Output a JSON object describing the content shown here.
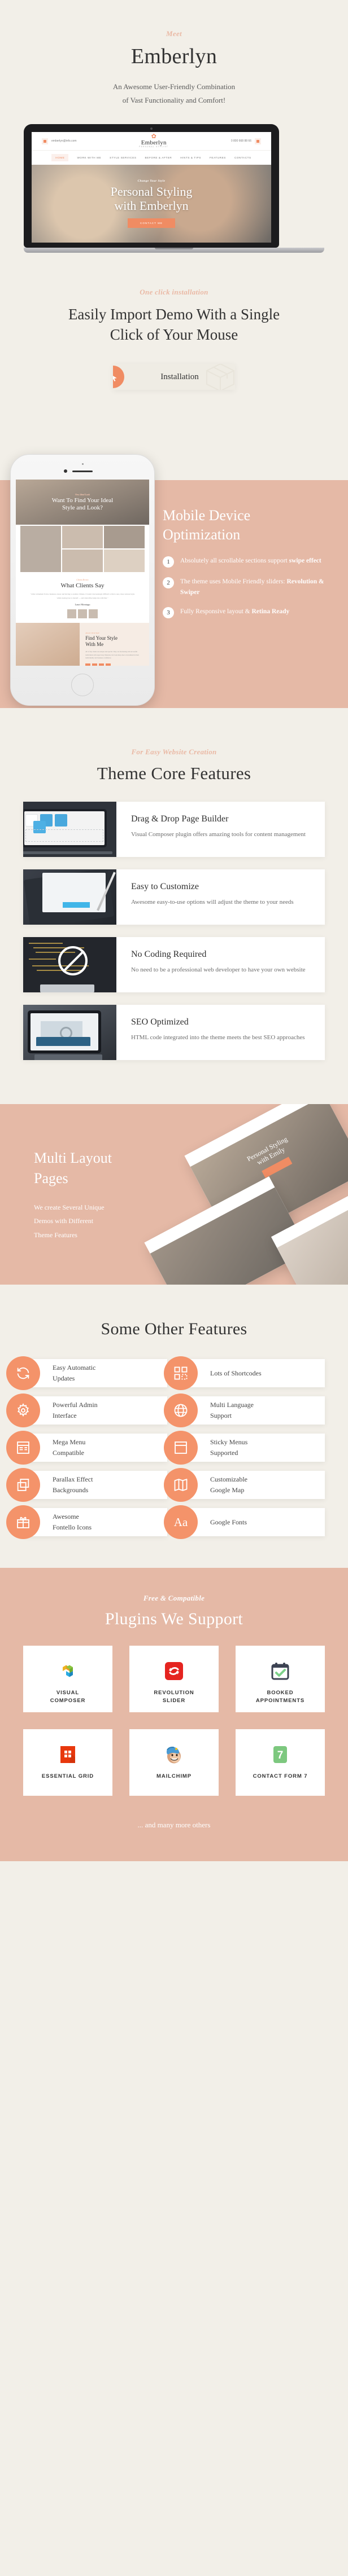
{
  "hero": {
    "eyebrow": "Meet",
    "title": "Emberlyn",
    "subtitle_line1": "An Awesome User-Friendly Combination",
    "subtitle_line2": "of Vast Functionality  and Comfort!",
    "laptop": {
      "email": "emberlyn@info.com",
      "phone": "0 800 668 88 66",
      "brand": "Emberlyn",
      "brand_tagline": "PERSONAL STYLIST",
      "nav": [
        "HOME",
        "WORK WITH ME",
        "STYLE SERVICES",
        "BEFORE & AFTER",
        "HINTS & TIPS",
        "FEATURES",
        "CONTACTS"
      ],
      "slide_eyebrow": "Change Your Style",
      "slide_title_line1": "Personal Styling",
      "slide_title_line2": "with Emberlyn",
      "slide_button": "CONTACT ME"
    }
  },
  "install": {
    "eyebrow": "One click installation",
    "title_line1": "Easily Import Demo With a Single",
    "title_line2": "Click of Your Mouse",
    "button_label": "Installation",
    "cursor_icon": "click-cursor-icon",
    "box_icon": "package-box-icon"
  },
  "mobile": {
    "title_line1": "Mobile Device",
    "title_line2": "Optimization",
    "items": [
      {
        "num": "1",
        "text": "Absolutely all scrollable sections support ",
        "bold": "swipe effect"
      },
      {
        "num": "2",
        "text": "The theme uses Mobile Friendly sliders: ",
        "bold": "Revolution & Swiper"
      },
      {
        "num": "3",
        "text": "Fully Responsive layout & ",
        "bold": "Retina Ready"
      }
    ],
    "phone_screen": {
      "hero_eyebrow": "New Ideal Look",
      "hero_title_line1": "Want To Find Your Ideal",
      "hero_title_line2": "Style and Look?",
      "clients_eyebrow": "Clients Review",
      "clients_title": "What Clients Say",
      "clients_quote": "\"After retirement from a business career and having to another climate, I found it increasingly difficult to find a new, more relaxed style while staying true to myself — and when Mae helps me with that.\"",
      "clients_name": "Lauri Montagu",
      "clients_role": "MY STYLIST",
      "find_eyebrow": "About Client Style",
      "find_title_line1": "Find Your Style",
      "find_title_line2": "With Me",
      "find_text": "All of my clients are unique and special. They are fascinating and successful individuals with super busy lifestyles, but look sharp due to investment in their individuality and business confidence."
    }
  },
  "core": {
    "eyebrow": "For Easy Website Creation",
    "title": "Theme Core Features",
    "features": [
      {
        "art": "art-vc",
        "title": "Drag & Drop Page Builder",
        "desc": "Visual Composer plugin offers amazing tools for content management",
        "art_caption": "Drag here to add widgets"
      },
      {
        "art": "art-cust",
        "title": "Easy to Customize",
        "desc": "Awesome easy-to-use options will adjust the theme to your needs"
      },
      {
        "art": "art-code",
        "title": "No Coding Required",
        "desc": "No need to be a professional web developer to have your own website"
      },
      {
        "art": "art-seo",
        "title": "SEO Optimized",
        "desc": "HTML code integrated into the theme meets the best SEO approaches"
      }
    ]
  },
  "multi": {
    "title_line1": "Multi Layout",
    "title_line2": "Pages",
    "desc_line1": "We create Several Unique",
    "desc_line2": "Demos with Different",
    "desc_line3": "Theme Features",
    "shot_title_line1": "Personal Styling",
    "shot_title_line2": "with Emily"
  },
  "other": {
    "title": "Some Other Features",
    "items": [
      {
        "icon": "refresh-icon",
        "label_line1": "Easy Automatic",
        "label_line2": "Updates"
      },
      {
        "icon": "shortcodes-grid-icon",
        "label_line1": "Lots of Shortcodes",
        "label_line2": ""
      },
      {
        "icon": "gear-icon",
        "label_line1": "Powerful Admin",
        "label_line2": "Interface"
      },
      {
        "icon": "globe-icon",
        "label_line1": "Multi Language",
        "label_line2": "Support"
      },
      {
        "icon": "mega-menu-icon",
        "label_line1": "Mega Menu",
        "label_line2": "Compatible"
      },
      {
        "icon": "sticky-menu-icon",
        "label_line1": "Sticky Menus",
        "label_line2": "Supported"
      },
      {
        "icon": "layers-icon",
        "label_line1": "Parallax Effect",
        "label_line2": "Backgrounds"
      },
      {
        "icon": "map-icon",
        "label_line1": "Customizable",
        "label_line2": "Google Map"
      },
      {
        "icon": "gift-icon",
        "label_line1": "Awesome",
        "label_line2": "Fontello Icons"
      },
      {
        "icon": "font-aa-icon",
        "label_line1": "Google Fonts",
        "label_line2": ""
      }
    ]
  },
  "plugins": {
    "eyebrow": "Free & Compatible",
    "title": "Plugins We Support",
    "items": [
      {
        "icon": "visual-composer-logo",
        "name_line1": "VISUAL",
        "name_line2": "COMPOSER"
      },
      {
        "icon": "revolution-slider-logo",
        "name_line1": "REVOLUTION",
        "name_line2": "SLIDER"
      },
      {
        "icon": "booked-appointments-logo",
        "name_line1": "BOOKED",
        "name_line2": "APPOINTMENTS"
      },
      {
        "icon": "essential-grid-logo",
        "name_line1": "ESSENTIAL GRID",
        "name_line2": ""
      },
      {
        "icon": "mailchimp-logo",
        "name_line1": "MAILCHIMP",
        "name_line2": ""
      },
      {
        "icon": "contact-form-7-logo",
        "name_line1": "CONTACT FORM 7",
        "name_line2": ""
      }
    ],
    "footer_note": "... and many more others"
  },
  "colors": {
    "cream": "#f2efe8",
    "peach": "#e5b9a6",
    "accent": "#f08c63",
    "accent_light": "#eab9a5",
    "dark": "#333333"
  }
}
